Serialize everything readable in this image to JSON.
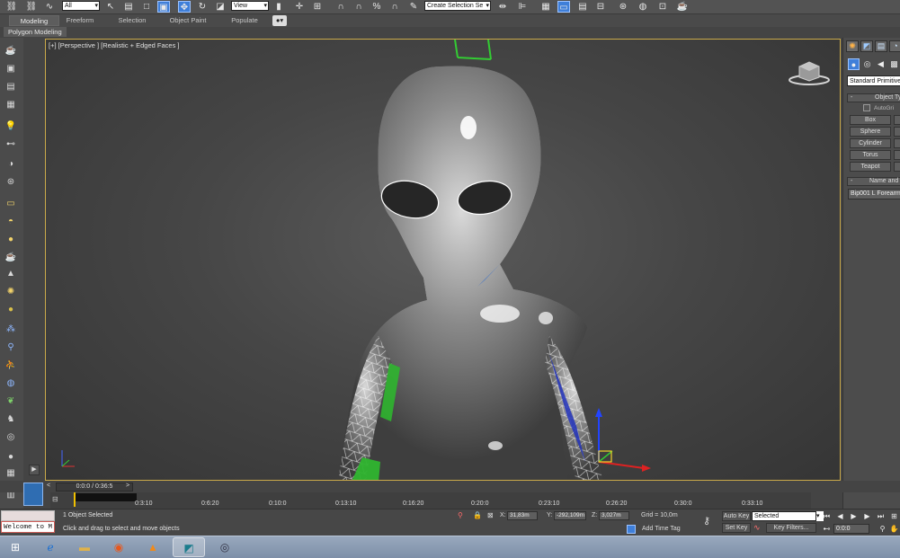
{
  "toolbar": {
    "filter_dropdown": "All",
    "refcoord_dropdown": "View",
    "selection_set_dropdown": "Create Selection Se"
  },
  "ribbon": {
    "tabs": [
      "Modeling",
      "Freeform",
      "Selection",
      "Object Paint",
      "Populate"
    ],
    "active_tab": "Modeling",
    "panel_label": "Polygon Modeling"
  },
  "viewport": {
    "label": "[+] [Perspective ] [Realistic + Edged Faces ]"
  },
  "command_panel": {
    "primitive_type": "Standard Primitives",
    "object_type_rollout": "Object Ty",
    "autogrid_label": "AutoGri",
    "buttons": [
      "Box",
      "Sphere",
      "Cylinder",
      "Torus",
      "Teapot"
    ],
    "name_color_rollout": "Name and C",
    "object_name": "Bip001 L Forearm"
  },
  "timeline": {
    "time_slider": "0:0:0 / 0:36:5",
    "prev_label": "<",
    "next_label": ">",
    "ticks": [
      "0:3:10",
      "0:6:20",
      "0:10:0",
      "0:13:10",
      "0:16:20",
      "0:20:0",
      "0:23:10",
      "0:26:20",
      "0:30:0",
      "0:33:10"
    ]
  },
  "status": {
    "maxscript": "Welcome to M",
    "selection_status": "1 Object Selected",
    "prompt": "Click and drag to select and move objects",
    "x_label": "X:",
    "x_value": "31,83m",
    "y_label": "Y:",
    "y_value": "-292,109m",
    "z_label": "Z:",
    "z_value": "3,027m",
    "grid": "Grid = 10,0m",
    "add_time_tag": "Add Time Tag",
    "auto_key": "Auto Key",
    "set_key": "Set Key",
    "key_mode_dropdown": "Selected",
    "key_filters": "Key Filters...",
    "current_frame": "0:0:0"
  },
  "colors": {
    "accent_blue": "#3f7fd9",
    "viewport_border": "#c9a94a",
    "taskbar": "#8a9bb3"
  }
}
